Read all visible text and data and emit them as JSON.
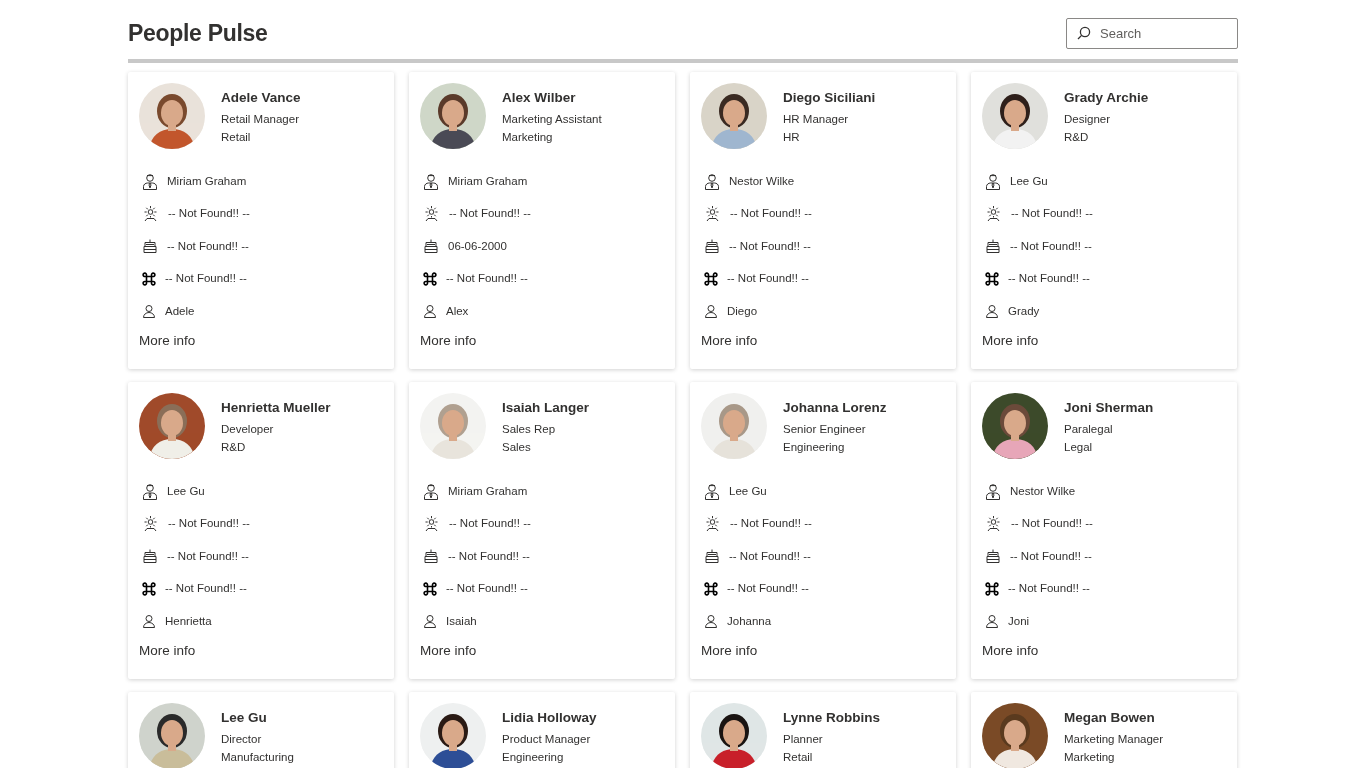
{
  "header": {
    "title": "People Pulse",
    "search": {
      "placeholder": "Search"
    }
  },
  "cards": [
    {
      "name": "Adele Vance",
      "title": "Retail Manager",
      "department": "Retail",
      "rows": [
        {
          "kind": "manager",
          "text": "Miriam Graham"
        },
        {
          "kind": "celebration",
          "text": "-- Not Found!! --"
        },
        {
          "kind": "birthday",
          "text": "-- Not Found!! --"
        },
        {
          "kind": "command",
          "text": "-- Not Found!! --"
        },
        {
          "kind": "person",
          "text": "Adele"
        }
      ],
      "link": "More info"
    },
    {
      "name": "Alex Wilber",
      "title": "Marketing Assistant",
      "department": "Marketing",
      "rows": [
        {
          "kind": "manager",
          "text": "Miriam Graham"
        },
        {
          "kind": "celebration",
          "text": "-- Not Found!! --"
        },
        {
          "kind": "birthday",
          "text": "06-06-2000"
        },
        {
          "kind": "command",
          "text": "-- Not Found!! --"
        },
        {
          "kind": "person",
          "text": "Alex"
        }
      ],
      "link": "More info"
    },
    {
      "name": "Diego Siciliani",
      "title": "HR Manager",
      "department": "HR",
      "rows": [
        {
          "kind": "manager",
          "text": "Nestor Wilke"
        },
        {
          "kind": "celebration",
          "text": "-- Not Found!! --"
        },
        {
          "kind": "birthday",
          "text": "-- Not Found!! --"
        },
        {
          "kind": "command",
          "text": "-- Not Found!! --"
        },
        {
          "kind": "person",
          "text": "Diego"
        }
      ],
      "link": "More info"
    },
    {
      "name": "Grady Archie",
      "title": "Designer",
      "department": "R&D",
      "rows": [
        {
          "kind": "manager",
          "text": "Lee Gu"
        },
        {
          "kind": "celebration",
          "text": "-- Not Found!! --"
        },
        {
          "kind": "birthday",
          "text": "-- Not Found!! --"
        },
        {
          "kind": "command",
          "text": "-- Not Found!! --"
        },
        {
          "kind": "person",
          "text": "Grady"
        }
      ],
      "link": "More info"
    },
    {
      "name": "Henrietta Mueller",
      "title": "Developer",
      "department": "R&D",
      "rows": [
        {
          "kind": "manager",
          "text": "Lee Gu"
        },
        {
          "kind": "celebration",
          "text": "-- Not Found!! --"
        },
        {
          "kind": "birthday",
          "text": "-- Not Found!! --"
        },
        {
          "kind": "command",
          "text": "-- Not Found!! --"
        },
        {
          "kind": "person",
          "text": "Henrietta"
        }
      ],
      "link": "More info"
    },
    {
      "name": "Isaiah Langer",
      "title": "Sales Rep",
      "department": "Sales",
      "rows": [
        {
          "kind": "manager",
          "text": "Miriam Graham"
        },
        {
          "kind": "celebration",
          "text": "-- Not Found!! --"
        },
        {
          "kind": "birthday",
          "text": "-- Not Found!! --"
        },
        {
          "kind": "command",
          "text": "-- Not Found!! --"
        },
        {
          "kind": "person",
          "text": "Isaiah"
        }
      ],
      "link": "More info"
    },
    {
      "name": "Johanna Lorenz",
      "title": "Senior Engineer",
      "department": "Engineering",
      "rows": [
        {
          "kind": "manager",
          "text": "Lee Gu"
        },
        {
          "kind": "celebration",
          "text": "-- Not Found!! --"
        },
        {
          "kind": "birthday",
          "text": "-- Not Found!! --"
        },
        {
          "kind": "command",
          "text": "-- Not Found!! --"
        },
        {
          "kind": "person",
          "text": "Johanna"
        }
      ],
      "link": "More info"
    },
    {
      "name": "Joni Sherman",
      "title": "Paralegal",
      "department": "Legal",
      "rows": [
        {
          "kind": "manager",
          "text": "Nestor Wilke"
        },
        {
          "kind": "celebration",
          "text": "-- Not Found!! --"
        },
        {
          "kind": "birthday",
          "text": "-- Not Found!! --"
        },
        {
          "kind": "command",
          "text": "-- Not Found!! --"
        },
        {
          "kind": "person",
          "text": "Joni"
        }
      ],
      "link": "More info"
    },
    {
      "name": "Lee Gu",
      "title": "Director",
      "department": "Manufacturing"
    },
    {
      "name": "Lidia Holloway",
      "title": "Product Manager",
      "department": "Engineering"
    },
    {
      "name": "Lynne Robbins",
      "title": "Planner",
      "department": "Retail"
    },
    {
      "name": "Megan Bowen",
      "title": "Marketing Manager",
      "department": "Marketing"
    }
  ]
}
